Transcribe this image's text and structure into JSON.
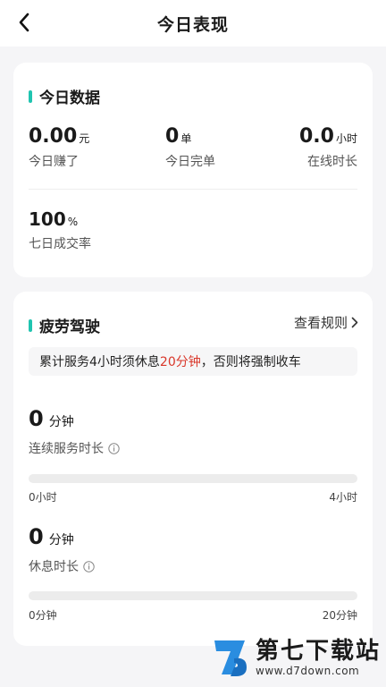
{
  "header": {
    "title": "今日表现",
    "back_icon": "chevron-left-icon"
  },
  "today": {
    "title": "今日数据",
    "accent_color": "#20c4b0",
    "earned": {
      "value": "0.00",
      "unit": "元",
      "label": "今日赚了"
    },
    "orders": {
      "value": "0",
      "unit": "单",
      "label": "今日完单"
    },
    "online": {
      "value": "0.0",
      "unit": "小时",
      "label": "在线时长"
    },
    "rate": {
      "value": "100",
      "unit": "%",
      "label": "七日成交率"
    }
  },
  "fatigue": {
    "title": "疲劳驾驶",
    "rules_link": "查看规则",
    "notice_prefix": "累计服务4小时须休息",
    "notice_highlight": "20分钟",
    "notice_suffix": "，否则将强制收车",
    "highlight_color": "#d9372a",
    "service": {
      "value": "0",
      "unit": "分钟",
      "label": "连续服务时长",
      "progress": 0,
      "min_label": "0小时",
      "max_label": "4小时"
    },
    "rest": {
      "value": "0",
      "unit": "分钟",
      "label": "休息时长",
      "progress": 0,
      "min_label": "0分钟",
      "max_label": "20分钟"
    }
  },
  "watermark": {
    "name": "第七下载站",
    "url": "www.d7down.com"
  }
}
